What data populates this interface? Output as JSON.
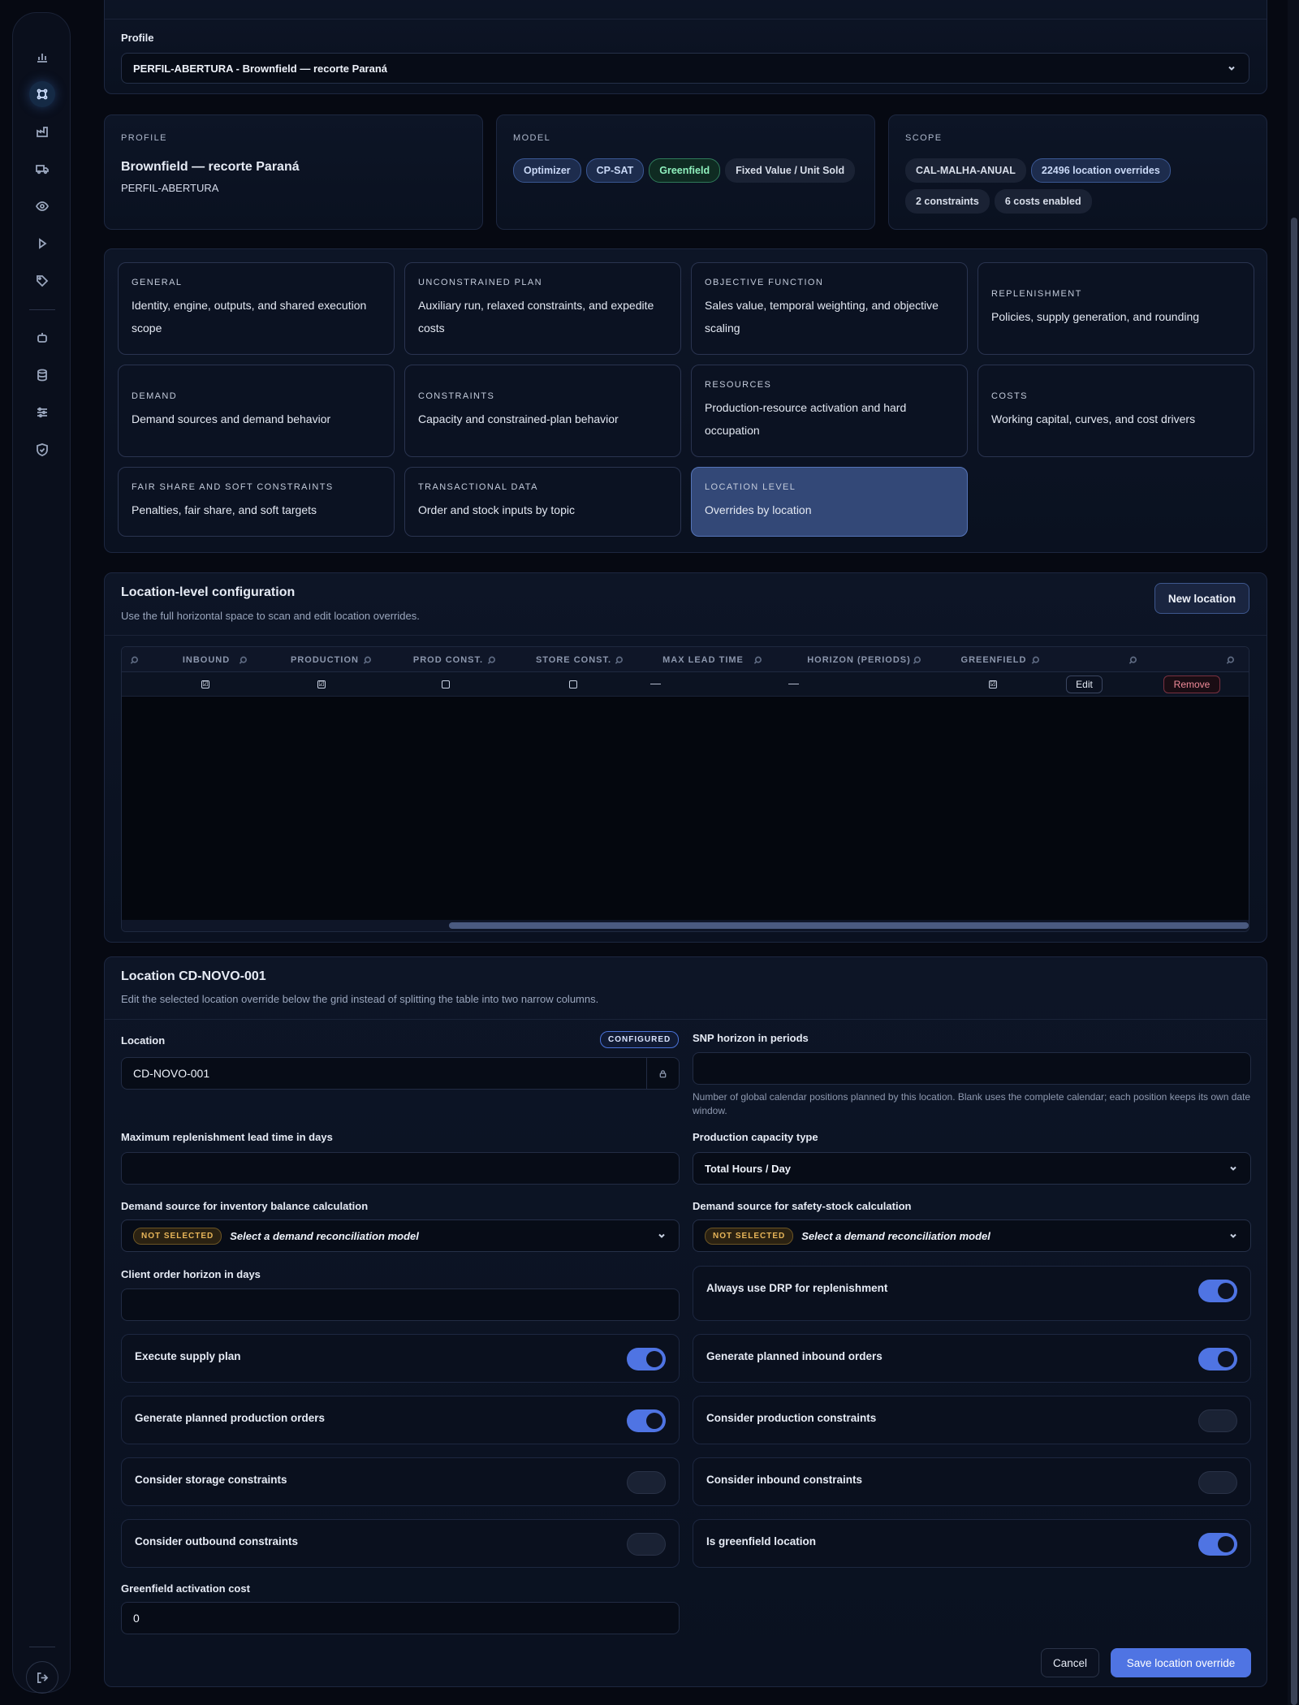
{
  "profile": {
    "label": "Profile",
    "selected": "PERFIL-ABERTURA - Brownfield — recorte Paraná"
  },
  "summary": {
    "profile": {
      "eyebrow": "PROFILE",
      "name": "Brownfield — recorte Paraná",
      "code": "PERFIL-ABERTURA"
    },
    "model": {
      "eyebrow": "MODEL",
      "chips": [
        "Optimizer",
        "CP-SAT",
        "Greenfield",
        "Fixed Value / Unit Sold"
      ]
    },
    "scope": {
      "eyebrow": "SCOPE",
      "chips": [
        "CAL-MALHA-ANUAL",
        "22496 location overrides",
        "2 constraints",
        "6 costs enabled"
      ]
    }
  },
  "sections": [
    {
      "title": "GENERAL",
      "desc": "Identity, engine, outputs, and shared execution scope"
    },
    {
      "title": "UNCONSTRAINED PLAN",
      "desc": "Auxiliary run, relaxed constraints, and expedite costs"
    },
    {
      "title": "OBJECTIVE FUNCTION",
      "desc": "Sales value, temporal weighting, and objective scaling"
    },
    {
      "title": "REPLENISHMENT",
      "desc": "Policies, supply generation, and rounding"
    },
    {
      "title": "DEMAND",
      "desc": "Demand sources and demand behavior"
    },
    {
      "title": "CONSTRAINTS",
      "desc": "Capacity and constrained-plan behavior"
    },
    {
      "title": "RESOURCES",
      "desc": "Production-resource activation and hard occupation"
    },
    {
      "title": "COSTS",
      "desc": "Working capital, curves, and cost drivers"
    },
    {
      "title": "FAIR SHARE AND SOFT CONSTRAINTS",
      "desc": "Penalties, fair share, and soft targets"
    },
    {
      "title": "TRANSACTIONAL DATA",
      "desc": "Order and stock inputs by topic"
    },
    {
      "title": "LOCATION LEVEL",
      "desc": "Overrides by location"
    }
  ],
  "location_config": {
    "title": "Location-level configuration",
    "subtitle": "Use the full horizontal space to scan and edit location overrides.",
    "new_button": "New location",
    "columns": [
      "INBOUND",
      "PRODUCTION",
      "PROD CONST.",
      "STORE CONST.",
      "MAX LEAD TIME",
      "HORIZON (PERIODS)",
      "GREENFIELD"
    ],
    "row": {
      "inbound": "☑",
      "production": "☑",
      "prod_const": "",
      "store_const": "",
      "max_lead_time": "—",
      "horizon": "—",
      "greenfield": "☑",
      "edit": "Edit",
      "remove": "Remove"
    }
  },
  "detail": {
    "title": "Location CD-NOVO-001",
    "subtitle": "Edit the selected location override below the grid instead of splitting the table into two narrow columns.",
    "location_label": "Location",
    "configured_badge": "CONFIGURED",
    "location_value": "CD-NOVO-001",
    "snp_label": "SNP horizon in periods",
    "snp_value": "",
    "snp_help": "Number of global calendar positions planned by this location. Blank uses the complete calendar; each position keeps its own date window.",
    "max_lead_label": "Maximum replenishment lead time in days",
    "max_lead_value": "",
    "capacity_label": "Production capacity type",
    "capacity_value": "Total Hours / Day",
    "inv_demand_label": "Demand source for inventory balance calculation",
    "ss_demand_label": "Demand source for safety-stock calculation",
    "not_selected": "NOT SELECTED",
    "demand_placeholder": "Select a demand reconciliation model",
    "client_horizon_label": "Client order horizon in days",
    "client_horizon_value": "",
    "toggles": [
      {
        "label": "Always use DRP for replenishment",
        "on": true
      },
      {
        "label": "Execute supply plan",
        "on": true
      },
      {
        "label": "Generate planned inbound orders",
        "on": true
      },
      {
        "label": "Generate planned production orders",
        "on": true
      },
      {
        "label": "Consider production constraints",
        "on": false
      },
      {
        "label": "Consider storage constraints",
        "on": false
      },
      {
        "label": "Consider inbound constraints",
        "on": false
      },
      {
        "label": "Consider outbound constraints",
        "on": false
      },
      {
        "label": "Is greenfield location",
        "on": true
      }
    ],
    "greenfield_cost_label": "Greenfield activation cost",
    "greenfield_cost_value": "0",
    "cancel": "Cancel",
    "save": "Save location override"
  },
  "colors": {
    "accent": "#4f74e3",
    "active_card": "#334877",
    "green": "#2f7a5a",
    "warning": "#e7b559"
  }
}
